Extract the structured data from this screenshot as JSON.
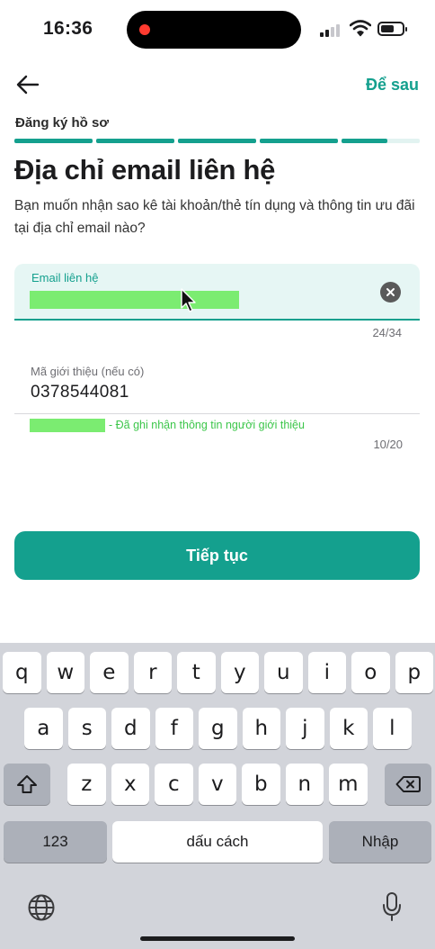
{
  "status_bar": {
    "time": "16:36",
    "recording_color": "#ff3b30",
    "signal_icon": "cellular-signal-icon",
    "wifi_icon": "wifi-icon",
    "battery_icon": "battery-icon",
    "battery_level": 0.65
  },
  "header": {
    "back_icon": "arrow-left-icon",
    "later_label": "Để sau",
    "step_label": "Đăng ký hồ sơ",
    "progress": {
      "total_segments": 5,
      "completed_fraction": 0.92
    }
  },
  "main": {
    "title": "Địa chỉ email liên hệ",
    "description": "Bạn muốn nhận sao kê tài khoản/thẻ tín dụng và thông tin ưu đãi tại địa chỉ email nào?",
    "email_field": {
      "label": "Email liên hệ",
      "value_redacted": true,
      "clear_icon": "clear-circle-icon",
      "counter": "24/34"
    },
    "referral_field": {
      "label": "Mã giới thiệu (nếu có)",
      "value": "0378544081",
      "note": "- Đã ghi nhận thông tin người giới thiệu",
      "counter": "10/20"
    },
    "continue_label": "Tiếp tục"
  },
  "keyboard": {
    "row1": [
      "q",
      "w",
      "e",
      "r",
      "t",
      "y",
      "u",
      "i",
      "o",
      "p"
    ],
    "row2": [
      "a",
      "s",
      "d",
      "f",
      "g",
      "h",
      "j",
      "k",
      "l"
    ],
    "row3": [
      "z",
      "x",
      "c",
      "v",
      "b",
      "n",
      "m"
    ],
    "numbers_label": "123",
    "space_label": "dấu cách",
    "return_label": "Nhập",
    "shift_icon": "shift-icon",
    "backspace_icon": "backspace-icon",
    "globe_icon": "globe-icon",
    "mic_icon": "microphone-icon"
  },
  "colors": {
    "accent": "#14a08e",
    "field_bg": "#e6f6f4",
    "success": "#3cc64a",
    "redaction": "#7bec71"
  }
}
